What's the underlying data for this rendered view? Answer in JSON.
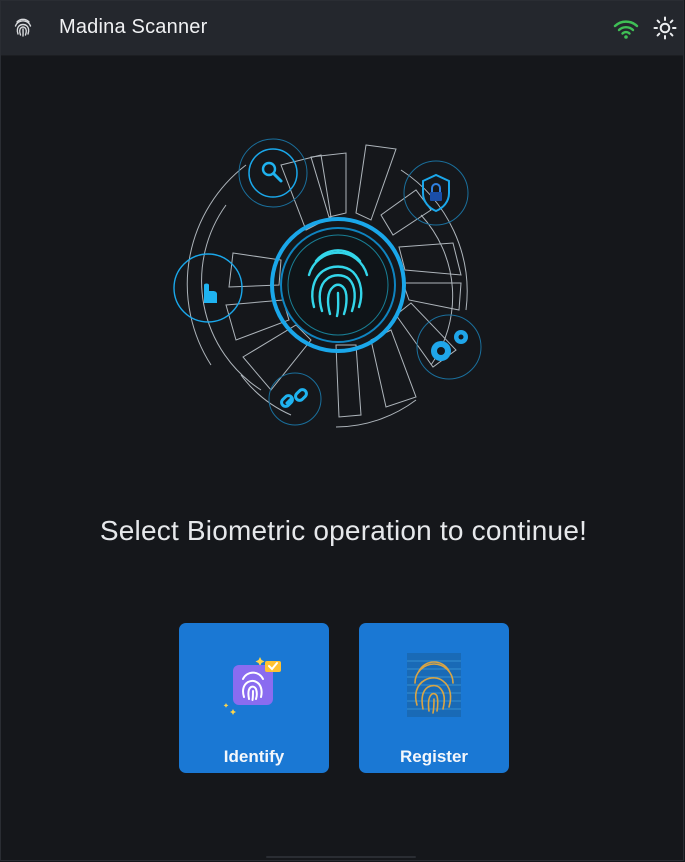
{
  "window": {
    "title": "Madina Scanner",
    "icons": {
      "app": "fingerprint-icon",
      "network": "wifi-icon",
      "theme": "sun-icon"
    },
    "colors": {
      "background": "#15171c",
      "titlebar": "#24272d",
      "wifi": "#3fbf55",
      "accent": "#1a78d4",
      "hero_glow": "#20a9e8"
    }
  },
  "main": {
    "prompt": "Select Biometric operation to continue!",
    "actions": [
      {
        "label": "Identify",
        "icon": "fingerprint-identify-icon"
      },
      {
        "label": "Register",
        "icon": "fingerprint-scan-register-icon"
      }
    ]
  }
}
